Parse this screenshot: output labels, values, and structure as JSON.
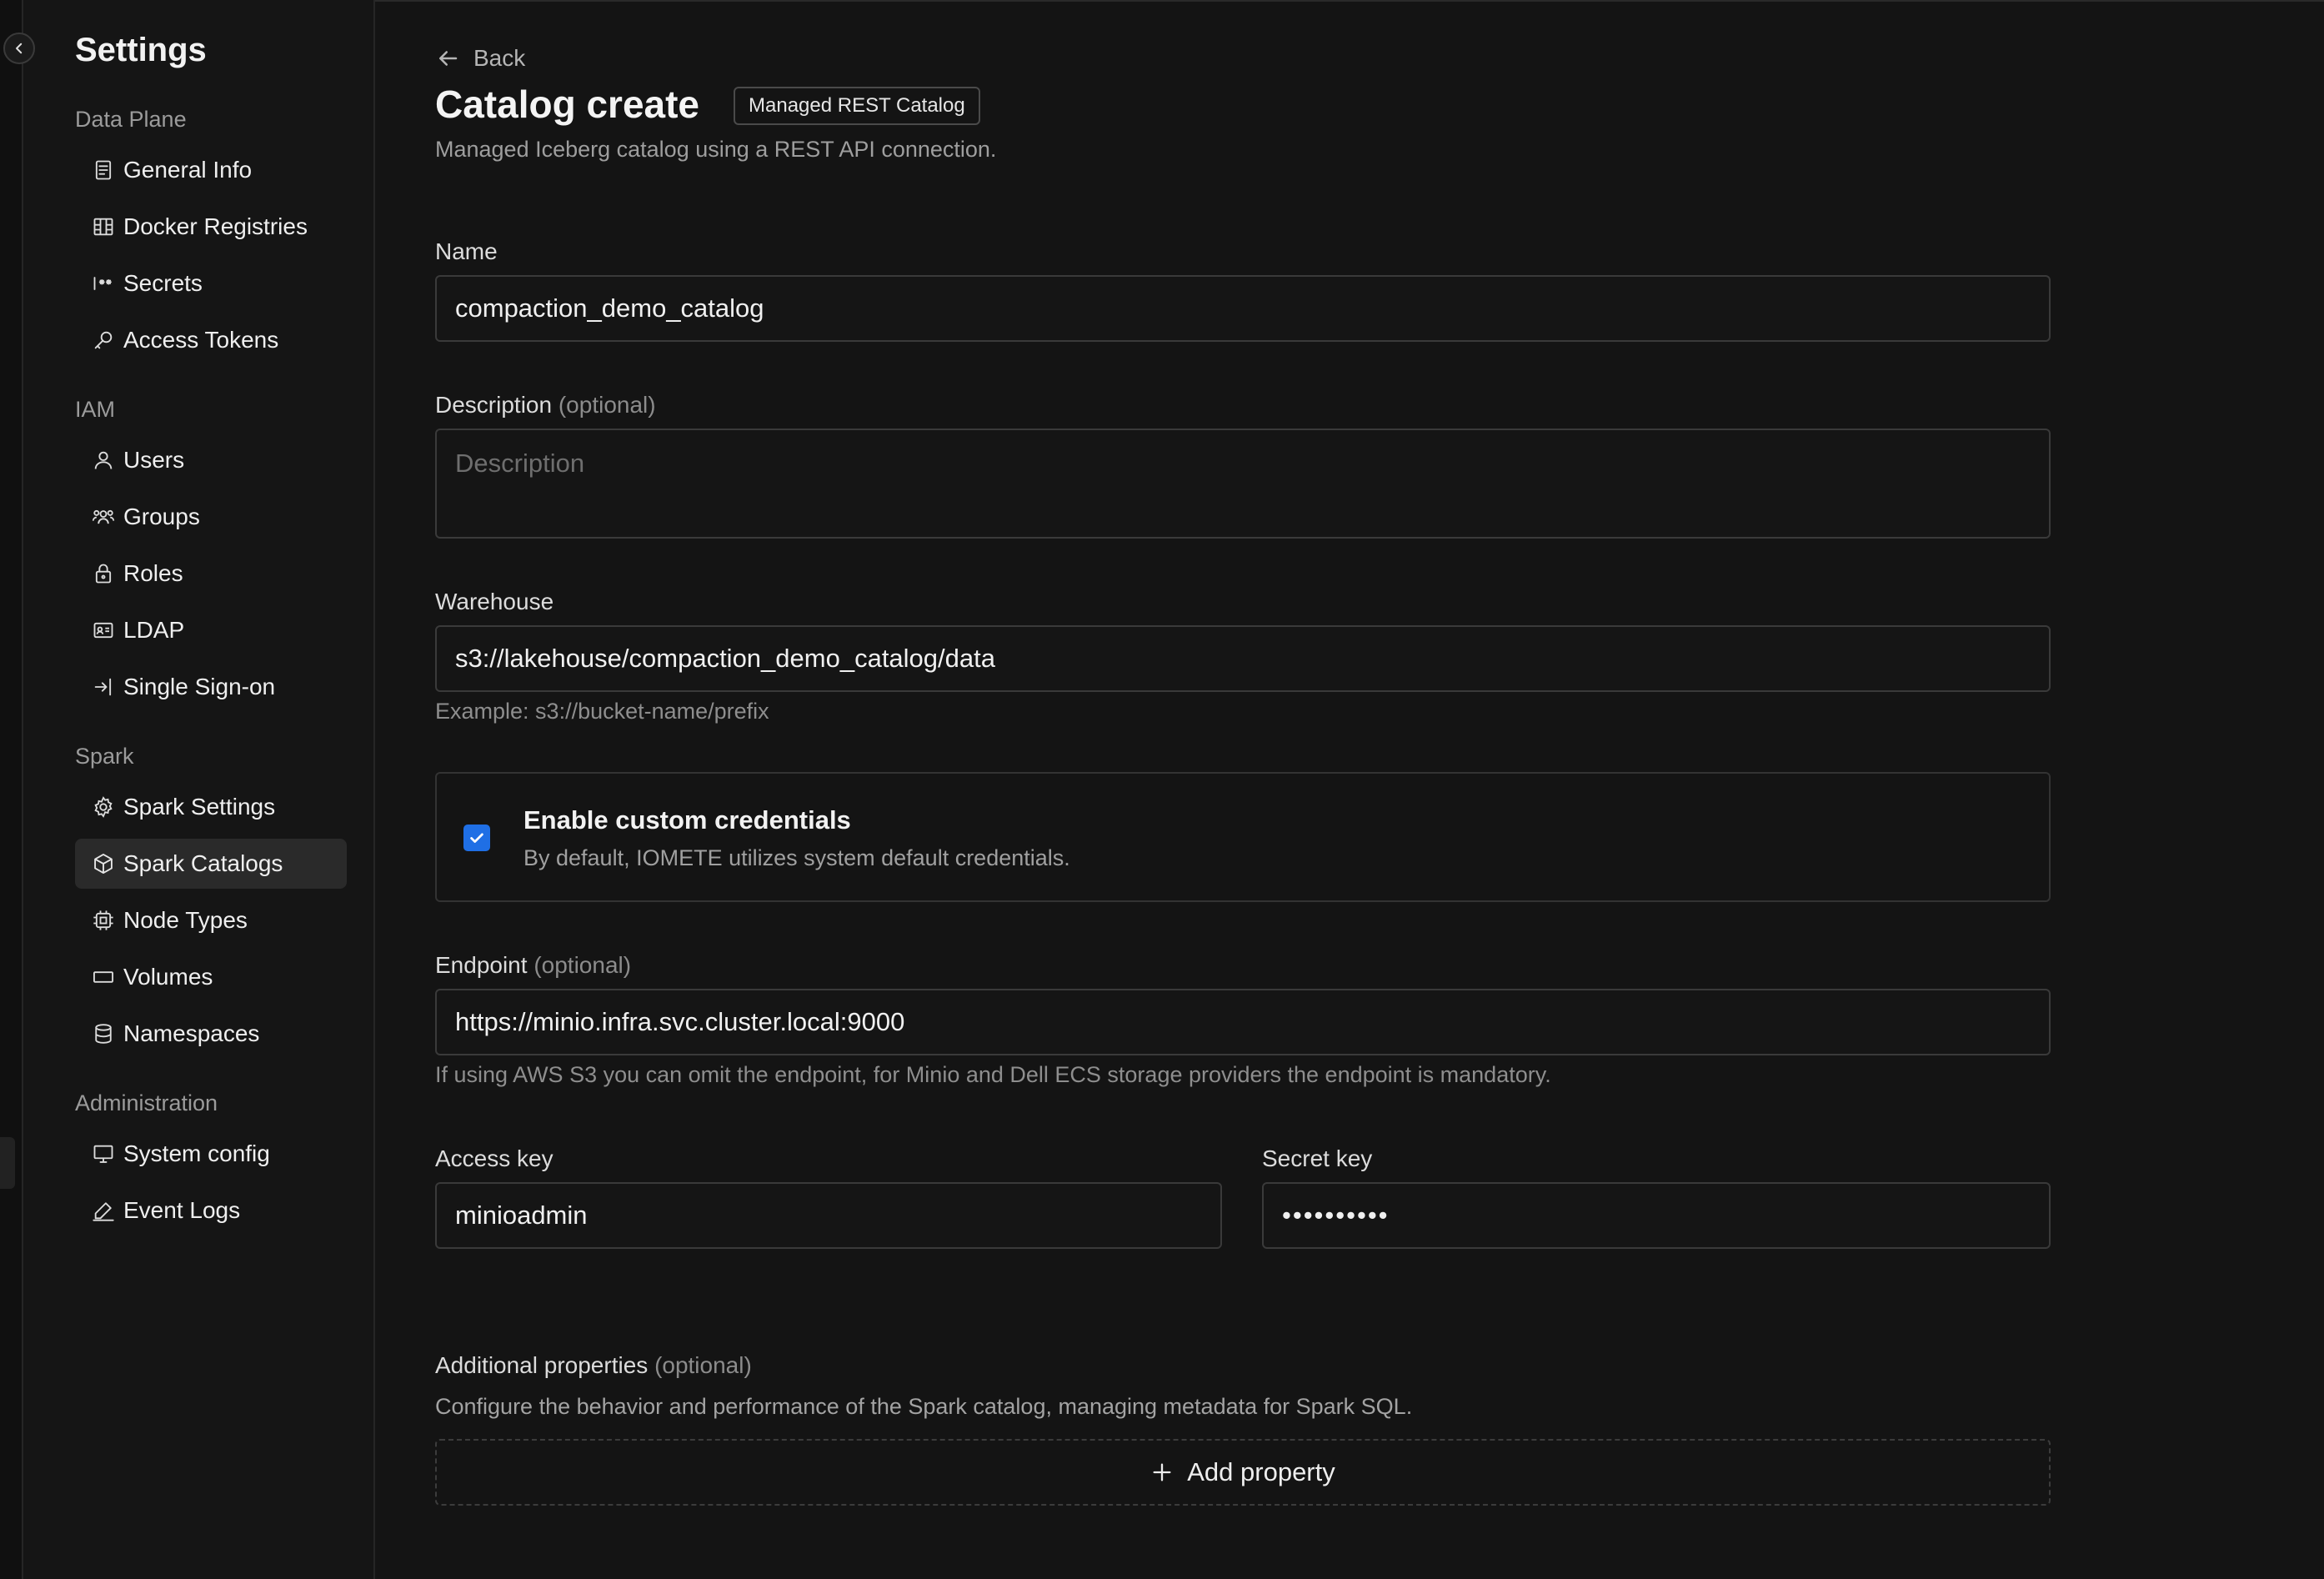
{
  "sidebar": {
    "title": "Settings",
    "sections": [
      {
        "label": "Data Plane",
        "items": [
          {
            "label": "General Info",
            "icon": "document-icon"
          },
          {
            "label": "Docker Registries",
            "icon": "registry-icon"
          },
          {
            "label": "Secrets",
            "icon": "password-icon"
          },
          {
            "label": "Access Tokens",
            "icon": "key-icon"
          }
        ]
      },
      {
        "label": "IAM",
        "items": [
          {
            "label": "Users",
            "icon": "user-icon"
          },
          {
            "label": "Groups",
            "icon": "users-icon"
          },
          {
            "label": "Roles",
            "icon": "lock-icon"
          },
          {
            "label": "LDAP",
            "icon": "id-card-icon"
          },
          {
            "label": "Single Sign-on",
            "icon": "sign-in-icon"
          }
        ]
      },
      {
        "label": "Spark",
        "items": [
          {
            "label": "Spark Settings",
            "icon": "gear-icon"
          },
          {
            "label": "Spark Catalogs",
            "icon": "cube-icon",
            "active": true
          },
          {
            "label": "Node Types",
            "icon": "chip-icon"
          },
          {
            "label": "Volumes",
            "icon": "volume-icon"
          },
          {
            "label": "Namespaces",
            "icon": "database-icon"
          }
        ]
      },
      {
        "label": "Administration",
        "items": [
          {
            "label": "System config",
            "icon": "monitor-icon"
          },
          {
            "label": "Event Logs",
            "icon": "signature-icon"
          }
        ]
      }
    ]
  },
  "header": {
    "back_label": "Back",
    "title": "Catalog create",
    "badge": "Managed REST Catalog",
    "subtitle": "Managed Iceberg catalog using a REST API connection."
  },
  "form": {
    "name": {
      "label": "Name",
      "value": "compaction_demo_catalog"
    },
    "description": {
      "label": "Description",
      "optional": "(optional)",
      "placeholder": "Description"
    },
    "warehouse": {
      "label": "Warehouse",
      "value": "s3://lakehouse/compaction_demo_catalog/data",
      "hint": "Example: s3://bucket-name/prefix"
    },
    "credentials": {
      "title": "Enable custom credentials",
      "description": "By default, IOMETE utilizes system default credentials.",
      "checked": true
    },
    "endpoint": {
      "label": "Endpoint",
      "optional": "(optional)",
      "value": "https://minio.infra.svc.cluster.local:9000",
      "hint": "If using AWS S3 you can omit the endpoint, for Minio and Dell ECS storage providers the endpoint is mandatory."
    },
    "access_key": {
      "label": "Access key",
      "value": "minioadmin"
    },
    "secret_key": {
      "label": "Secret key",
      "value": "••••••••••"
    },
    "additional": {
      "label": "Additional properties",
      "optional": "(optional)",
      "description": "Configure the behavior and performance of the Spark catalog, managing metadata for Spark SQL.",
      "add_label": "Add property"
    }
  },
  "colors": {
    "accent": "#1f6fe5",
    "background": "#141414"
  }
}
